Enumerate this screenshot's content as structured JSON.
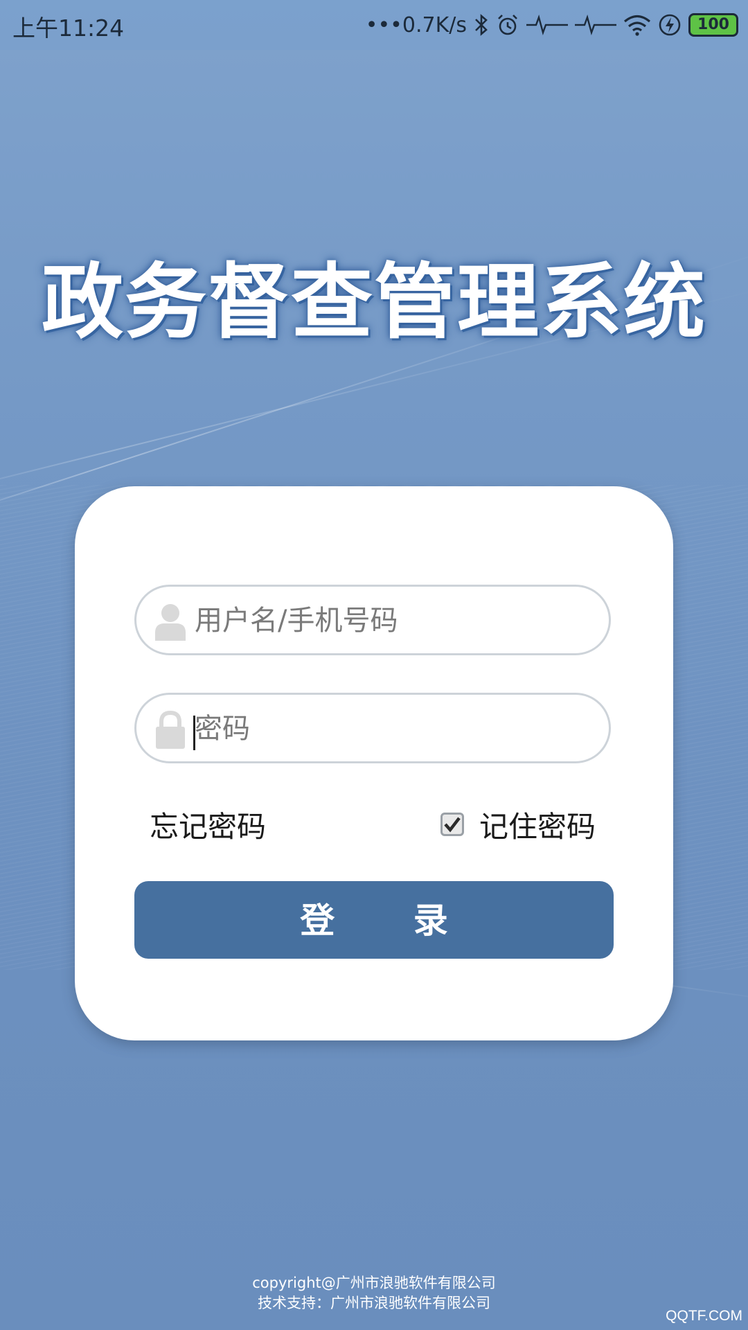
{
  "status_bar": {
    "time": "上午11:24",
    "network_speed": "•••0.7K/s",
    "battery": "100",
    "icons": [
      "bluetooth-icon",
      "alarm-icon",
      "activity-icon",
      "activity-icon",
      "wifi-icon",
      "charging-icon",
      "battery-icon"
    ]
  },
  "header": {
    "title": "政务督查管理系统"
  },
  "login": {
    "username_placeholder": "用户名/手机号码",
    "password_placeholder": "密码",
    "forgot_label": "忘记密码",
    "remember_label": "记住密码",
    "remember_checked": true,
    "submit_label": "登 录"
  },
  "footer": {
    "copyright": "copyright@广州市浪驰软件有限公司",
    "support": "技术支持：广州市浪驰软件有限公司"
  },
  "watermark": "QQTF.COM",
  "colors": {
    "background": "#7599c6",
    "button": "#46709f",
    "card": "#ffffff",
    "battery": "#5ec246"
  }
}
